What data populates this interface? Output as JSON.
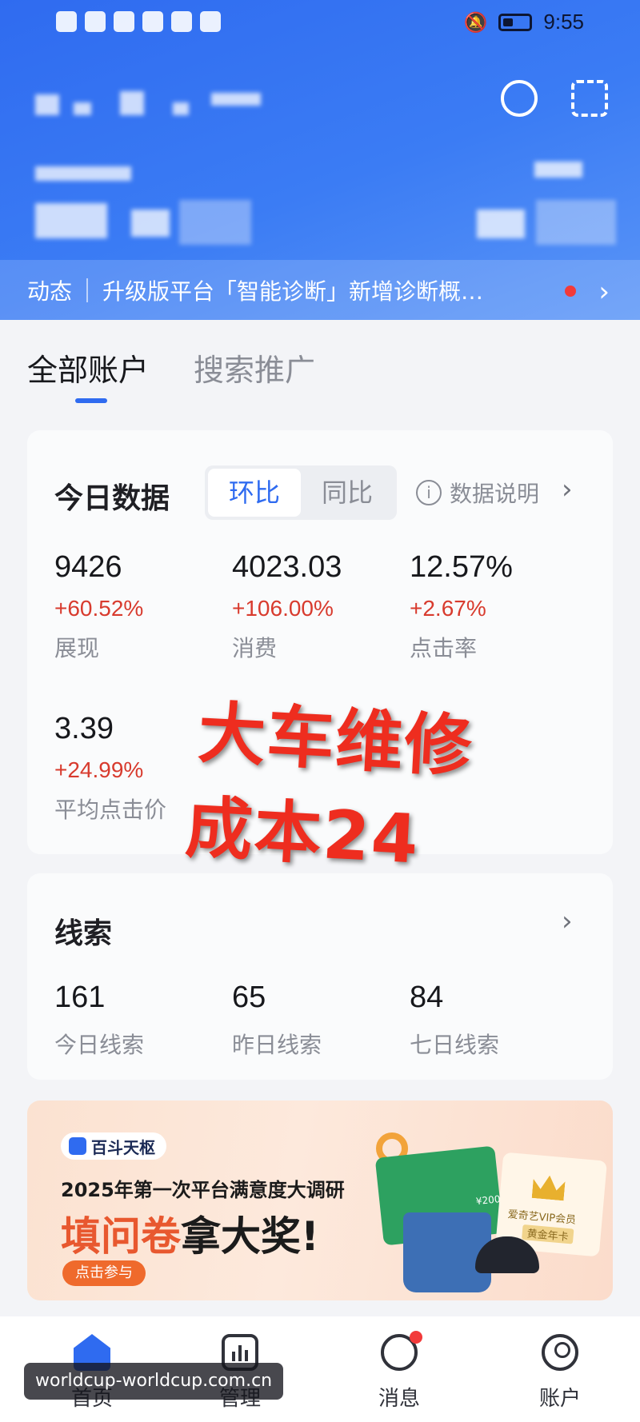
{
  "status_bar": {
    "time": "9:55"
  },
  "notice": {
    "tag": "动态",
    "text": "升级版平台「智能诊断」新增诊断概…"
  },
  "tabs": [
    {
      "label": "全部账户",
      "active": true
    },
    {
      "label": "搜索推广",
      "active": false
    }
  ],
  "today": {
    "title": "今日数据",
    "compare_options": [
      "环比",
      "同比"
    ],
    "selected_compare": "环比",
    "data_explain": "数据说明",
    "metrics": [
      {
        "value": "9426",
        "change": "+60.52%",
        "label": "展现"
      },
      {
        "value": "4023.03",
        "change": "+106.00%",
        "label": "消费"
      },
      {
        "value": "12.57%",
        "change": "+2.67%",
        "label": "点击率"
      },
      {
        "value": "3.39",
        "change": "+24.99%",
        "label": "平均点击价"
      }
    ]
  },
  "overlay": {
    "line1": "大车维修",
    "line2": "成本24"
  },
  "leads": {
    "title": "线索",
    "items": [
      {
        "value": "161",
        "label": "今日线索"
      },
      {
        "value": "65",
        "label": "昨日线索"
      },
      {
        "value": "84",
        "label": "七日线索"
      }
    ]
  },
  "banner": {
    "brand": "百斗天枢",
    "title": "2025年第一次平台满意度大调研",
    "big_accent": "填问卷",
    "big_rest": "拿大奖!",
    "cta": "点击参与",
    "card_amount": "¥200",
    "vip_text": "爱奇艺VIP会员",
    "vip_sub": "黄金年卡"
  },
  "nav": [
    {
      "label": "首页",
      "icon": "home-icon",
      "active": true
    },
    {
      "label": "管理",
      "icon": "chart-icon",
      "active": false
    },
    {
      "label": "消息",
      "icon": "message-icon",
      "active": false
    },
    {
      "label": "账户",
      "icon": "user-icon",
      "active": false
    }
  ],
  "watermark": "worldcup-worldcup.com.cn",
  "colors": {
    "primary": "#2f6bf0",
    "increase": "#d83b2e",
    "overlay": "#ee2d1f",
    "cta": "#ef6a2c"
  }
}
